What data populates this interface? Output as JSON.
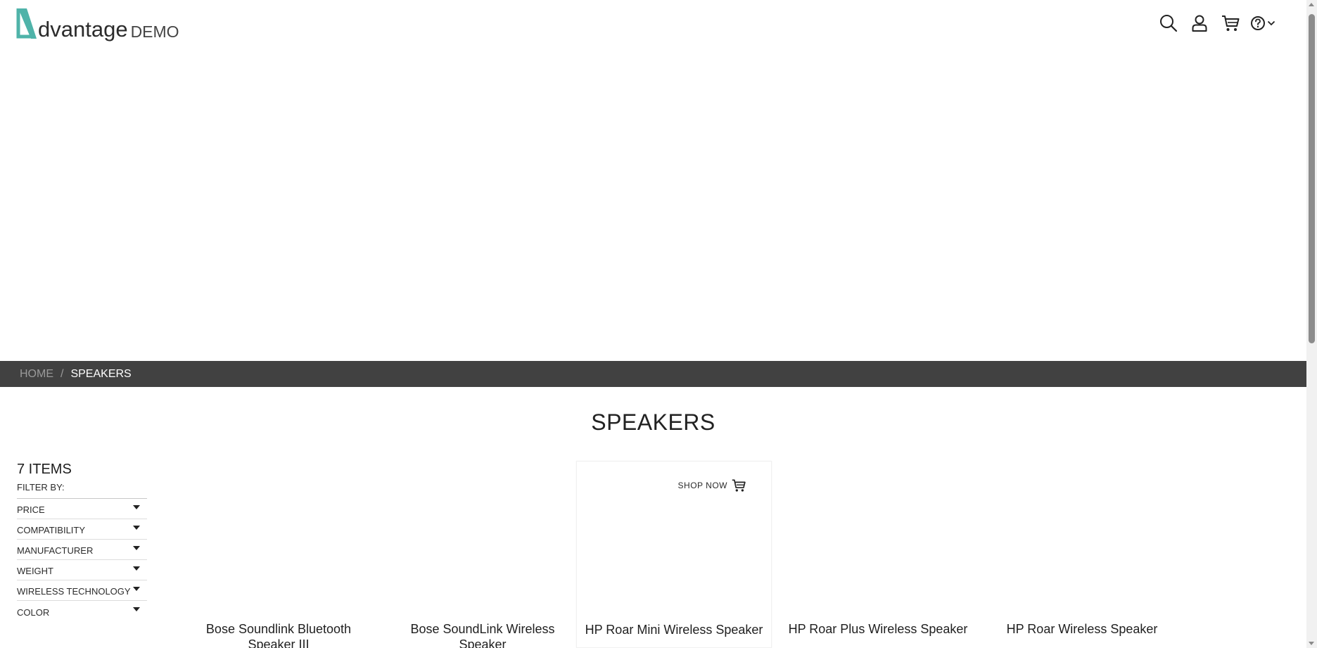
{
  "brand": {
    "name": "dvantage",
    "suffix": "DEMO",
    "accent_color": "#4fb3a9"
  },
  "header": {
    "icons": [
      "search-icon",
      "user-icon",
      "cart-icon",
      "help-icon",
      "chevron-down-icon"
    ]
  },
  "breadcrumb": {
    "home": "HOME",
    "separator": "/",
    "current": "SPEAKERS"
  },
  "page": {
    "title": "SPEAKERS"
  },
  "filters": {
    "count_label": "7 ITEMS",
    "filter_by_label": "FILTER BY:",
    "items": [
      {
        "label": "PRICE"
      },
      {
        "label": "COMPATIBILITY"
      },
      {
        "label": "MANUFACTURER"
      },
      {
        "label": "WEIGHT"
      },
      {
        "label": "WIRELESS TECHNOLOGY"
      },
      {
        "label": "COLOR"
      }
    ]
  },
  "products": [
    {
      "name": "Bose Soundlink Bluetooth Speaker III"
    },
    {
      "name": "Bose SoundLink Wireless Speaker"
    },
    {
      "name": "HP Roar Mini Wireless Speaker",
      "shop_now": "SHOP NOW"
    },
    {
      "name": "HP Roar Plus Wireless Speaker"
    },
    {
      "name": "HP Roar Wireless Speaker"
    }
  ]
}
